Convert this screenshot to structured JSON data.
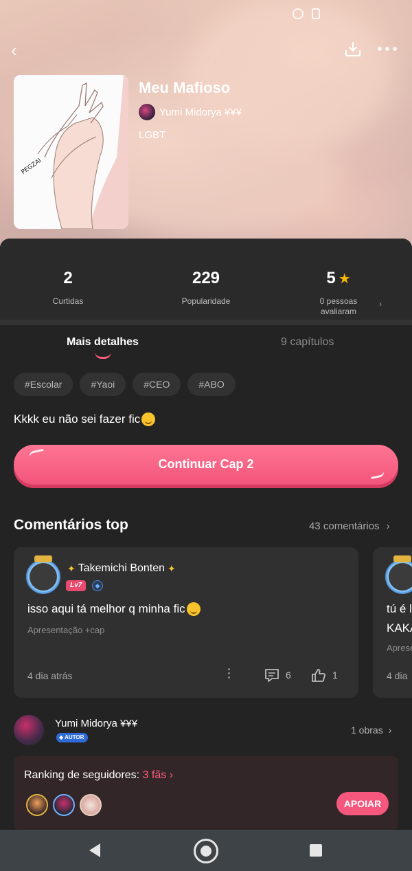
{
  "story": {
    "title": "Meu Mafioso",
    "author": "Yumi Midorya ¥¥¥",
    "genre": "LGBT"
  },
  "stats": {
    "likes_value": "2",
    "likes_label": "Curtidas",
    "popularity_value": "229",
    "popularity_label": "Popularidade",
    "rating_value": "5",
    "rating_label_line1": "0 pessoas",
    "rating_label_line2": "avaliaram"
  },
  "tabs": {
    "details": "Mais detalhes",
    "chapters": "9 capítulos"
  },
  "tags": [
    "#Escolar",
    "#Yaoi",
    "#CEO",
    "#ABO"
  ],
  "description": "Kkkk eu não sei fazer fic",
  "continue_button": "Continuar Cap 2",
  "comments_section": {
    "title": "Comentários top",
    "count_link": "43 comentários"
  },
  "comments": [
    {
      "username": "Takemichi Bonten",
      "level": "Lv7",
      "text": "isso aqui tá melhor q minha fic",
      "source": "Apresentação +cap",
      "time": "4 dia atrás",
      "replies": "6",
      "likes": "1"
    },
    {
      "text_line1": "tú é l",
      "text_line2": "KAKA",
      "source": "Aprese",
      "time": "4 dia"
    }
  ],
  "author_block": {
    "name": "Yumi Midorya ¥¥¥",
    "badge": "AUTOR",
    "works": "1 obras"
  },
  "ranking": {
    "label": "Ranking de seguidores:",
    "count": "3 fãs",
    "support_button": "APOIAR"
  },
  "colors": {
    "accent": "#f5577d",
    "panel": "#232323",
    "star": "#f6b800"
  }
}
